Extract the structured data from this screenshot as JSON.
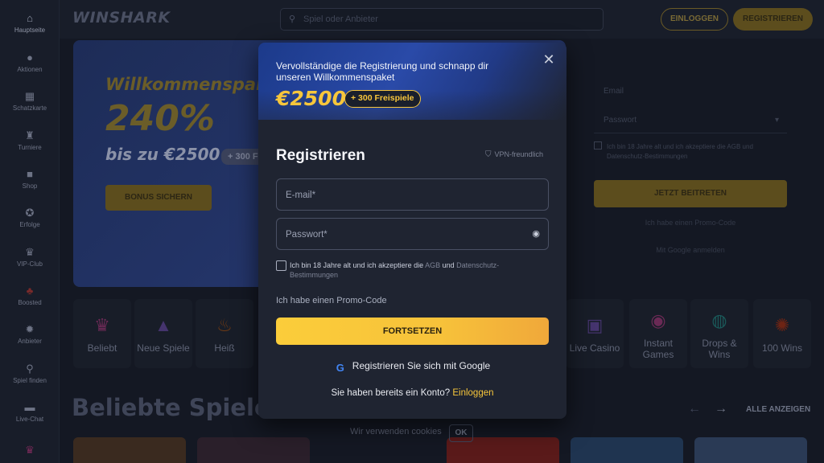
{
  "sidebar": {
    "items": [
      {
        "label": "Hauptseite",
        "icon": "home-icon"
      },
      {
        "label": "Aktionen",
        "icon": "promo-icon"
      },
      {
        "label": "Schatzkarte",
        "icon": "map-icon"
      },
      {
        "label": "Turniere",
        "icon": "trophy-icon"
      },
      {
        "label": "Shop",
        "icon": "shop-icon"
      },
      {
        "label": "Erfolge",
        "icon": "achievement-icon"
      },
      {
        "label": "VIP-Club",
        "icon": "vip-icon"
      },
      {
        "label": "Boosted",
        "icon": "boost-icon"
      },
      {
        "label": "Anbieter",
        "icon": "provider-icon"
      },
      {
        "label": "Spiel finden",
        "icon": "search-icon"
      },
      {
        "label": "Live-Chat",
        "icon": "chat-icon"
      }
    ]
  },
  "header": {
    "logo": "WINSHARK",
    "search_placeholder": "Spiel oder Anbieter",
    "login_label": "EINLOGGEN",
    "register_label": "REGISTRIEREN"
  },
  "banner": {
    "line1": "Willkommenspaket",
    "line2": "240%",
    "line3": "bis zu €2500",
    "badge": "+ 300 FS",
    "button": "BONUS SICHERN"
  },
  "right_panel": {
    "label": "Email",
    "select": "Passwort",
    "checkbox": "Ich bin 18 Jahre alt und ich akzeptiere die AGB und Datenschutz-Bestimmungen",
    "button": "JETZT BEITRETEN",
    "line1": "Ich habe einen Promo-Code",
    "line2": "Mit Google anmelden"
  },
  "categories": [
    {
      "label": "Beliebt",
      "icon": "crown-icon",
      "color": "#c2409a"
    },
    {
      "label": "Neue Spiele",
      "icon": "hat-icon",
      "color": "#7a55c2"
    },
    {
      "label": "Heiß",
      "icon": "fire-icon",
      "color": "#e06a1a"
    },
    {
      "label": "Live Casino",
      "icon": "live-icon",
      "color": "#7a55c2"
    },
    {
      "label": "Instant Games",
      "icon": "instant-icon",
      "color": "#c2409a"
    },
    {
      "label": "Drops & Wins",
      "icon": "drops-icon",
      "color": "#1aa3a3"
    },
    {
      "label": "100 Wins",
      "icon": "wins-icon",
      "color": "#e0361a"
    }
  ],
  "section": {
    "title": "Beliebte Spiele",
    "show_all": "ALLE ANZEIGEN"
  },
  "cookie": {
    "text": "Wir verwenden cookies",
    "ok": "OK"
  },
  "modal": {
    "intro": "Vervollständige die Registrierung und schnapp dir unseren Willkommenspaket",
    "amount": "€2500",
    "badge": "+ 300 Freispiele",
    "title": "Registrieren",
    "vpn": "VPN-freundlich",
    "email_placeholder": "E-mail*",
    "password_placeholder": "Passwort*",
    "terms_prefix": "Ich bin 18 Jahre alt und ich akzeptiere die ",
    "terms_link1": "AGB",
    "terms_middle": " und ",
    "terms_link2": "Datenschutz-Bestimmungen",
    "promo": "Ich habe einen Promo-Code",
    "continue": "FORTSETZEN",
    "google": "Registrieren Sie sich mit Google",
    "login_prefix": "Sie haben bereits ein Konto? ",
    "login_link": "Einloggen"
  },
  "colors": {
    "accent": "#f7c63b",
    "background": "#141823",
    "modal": "#1f2431"
  }
}
